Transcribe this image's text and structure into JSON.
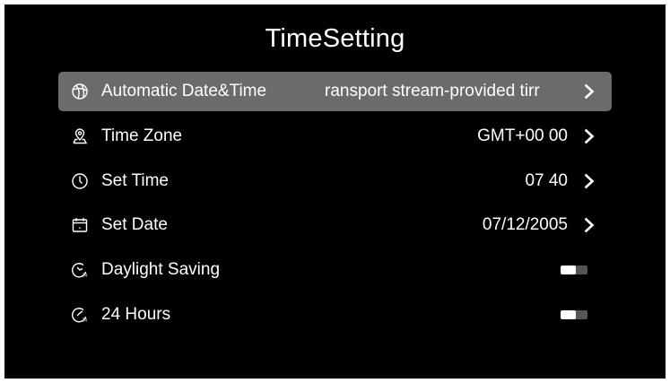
{
  "page": {
    "title": "TimeSetting"
  },
  "settings": [
    {
      "label": "Automatic Date&Time",
      "value": "ransport stream-provided tirr",
      "icon": "globe-icon",
      "control": "chevron",
      "selected": true
    },
    {
      "label": "Time Zone",
      "value": "GMT+00 00",
      "icon": "location-pin-icon",
      "control": "chevron",
      "selected": false
    },
    {
      "label": "Set Time",
      "value": "07 40",
      "icon": "clock-icon",
      "control": "chevron",
      "selected": false
    },
    {
      "label": "Set Date",
      "value": "07/12/2005",
      "icon": "calendar-icon",
      "control": "chevron",
      "selected": false
    },
    {
      "label": "Daylight Saving",
      "icon": "daylight-clock-icon",
      "control": "toggle",
      "toggle_on": false,
      "selected": false
    },
    {
      "label": "24 Hours",
      "icon": "clock-24-icon",
      "control": "toggle",
      "toggle_on": false,
      "selected": false
    }
  ],
  "colors": {
    "background": "#000000",
    "selected_row": "#6b6b6b",
    "text": "#ffffff",
    "toggle_track": "#555555"
  }
}
